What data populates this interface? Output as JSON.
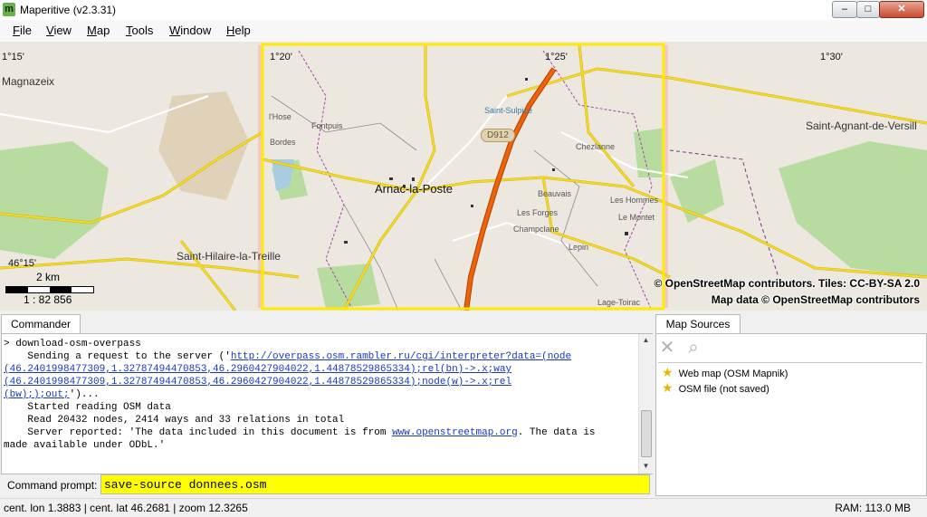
{
  "window": {
    "title": "Maperitive (v2.3.31)",
    "app_icon_letter": "m",
    "minimize_glyph": "–",
    "maximize_glyph": "□",
    "close_glyph": "✕"
  },
  "menu": {
    "items": [
      {
        "accel": "F",
        "rest": "ile"
      },
      {
        "accel": "V",
        "rest": "iew"
      },
      {
        "accel": "M",
        "rest": "ap"
      },
      {
        "accel": "T",
        "rest": "ools"
      },
      {
        "accel": "W",
        "rest": "indow"
      },
      {
        "accel": "H",
        "rest": "elp"
      }
    ]
  },
  "map": {
    "coords": {
      "c1": "1°15'",
      "c2": "1°20'",
      "c3": "1°25'",
      "c4": "1°30'",
      "lat": "46°15'"
    },
    "places": {
      "magnazeix": "Magnazeix",
      "arnac": "Arnac-la-Poste",
      "saint_agnant": "Saint-Agnant-de-Versill",
      "saint_hilaire": "Saint-Hilaire-la-Treille",
      "saint_sulpice": "Saint-Sulpice",
      "chezlanne": "Chezlanne",
      "beauvais": "Beauvais",
      "les_homes": "Les Hommes",
      "le_montet": "Le Montet",
      "les_forges": "Les Forges",
      "champclane": "Champclane",
      "le_pin": "Lepin",
      "lage": "Lage-Toirac",
      "bordes": "Bordes",
      "fontpuis": "Fontpuis",
      "lhose": "l'Hose"
    },
    "road_badge": "D912",
    "scale_distance": "2 km",
    "scale_ratio": "1 : 82 856",
    "attribution_tiles": "© OpenStreetMap contributors. Tiles: CC-BY-SA 2.0",
    "attribution_data": "Map data © OpenStreetMap contributors",
    "colors": {
      "land": "#ece8df",
      "selection": "#ffea00",
      "motorway": "#f0620a",
      "road": "#f2d92c",
      "forest": "#b8dba0",
      "water": "#a8cde0",
      "boundary": "#a04aa8"
    }
  },
  "commander": {
    "tab_label": "Commander",
    "lines": {
      "l1": "> download-osm-overpass",
      "l2_pre": "    Sending a request to the server ('",
      "l2_url": "http://overpass.osm.rambler.ru/cgi/interpreter?data=(node",
      "l3_url": "(46.2401998477309,1.32787494470853,46.2960427904022,1.44878529865334);rel(bn)->.x;way",
      "l4_url": "(46.2401998477309,1.32787494470853,46.2960427904022,1.44878529865334);node(w)->.x;rel",
      "l5_url": "(bw););out;",
      "l5_post": "')...",
      "l6": "    Started reading OSM data",
      "l7": "    Read 20432 nodes, 2414 ways and 33 relations in total",
      "l8_pre": "    Server reported: 'The data included in this document is from ",
      "l8_url": "www.openstreetmap.org",
      "l8_post": ". The data is",
      "l9": "made available under ODbL.'"
    },
    "scroll_up": "▲",
    "scroll_down": "▼",
    "prompt_label": "Command prompt:",
    "prompt_value": "save-source donnees.osm"
  },
  "sources": {
    "tab_label": "Map Sources",
    "remove_glyph": "✕",
    "zoom_glyph": "⌕",
    "items": [
      {
        "star": "★",
        "label": "Web map (OSM Mapnik)"
      },
      {
        "star": "★",
        "label": "OSM file (not saved)"
      }
    ]
  },
  "status": {
    "position": "cent. lon 1.3883 | cent. lat 46.2681 | zoom 12.3265",
    "ram": "RAM: 113.0 MB"
  }
}
